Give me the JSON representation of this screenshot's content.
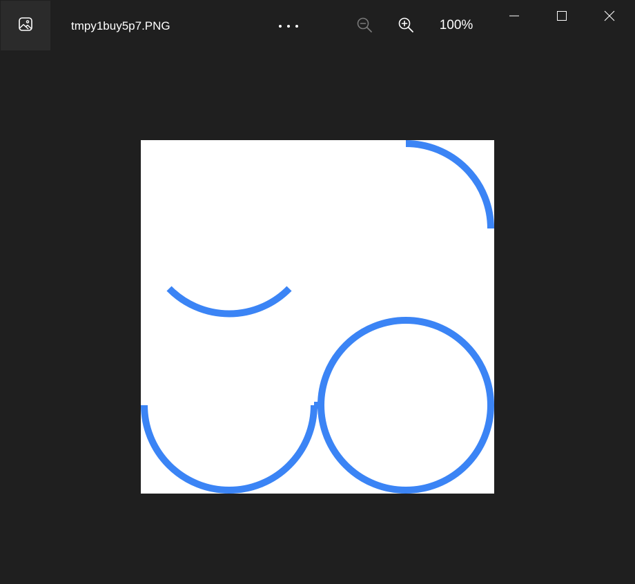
{
  "titlebar": {
    "file_name": "tmpy1buy5p7.PNG",
    "zoom_level": "100%",
    "icons": {
      "app": "photos-app-icon",
      "more": "more-horizontal-icon",
      "zoom_out": "zoom-out-icon",
      "zoom_in": "zoom-in-icon",
      "minimize": "minimize-icon",
      "maximize": "maximize-icon",
      "close": "close-icon"
    }
  },
  "colors": {
    "background": "#1f1f1f",
    "image_background": "#ffffff",
    "stroke": "#3b84f5",
    "disabled_icon": "#7a7a7a"
  }
}
